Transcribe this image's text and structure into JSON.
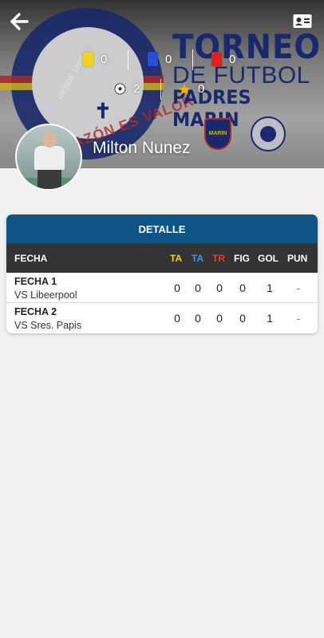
{
  "banner": {
    "title_line1": "TORNEO",
    "title_line2": "DE FUTBOL",
    "title_line3": "PADRES MARIN",
    "logo_text": "CORAZÓN ES VALOR",
    "logo_year": "DESDE 1992",
    "crest_text": "MARIN",
    "colors": {
      "navy": "#1d2f7a",
      "red": "#c9302c",
      "yellow": "#e6c52c"
    }
  },
  "stats": {
    "yellow_cards": "0",
    "blue_cards": "0",
    "red_cards": "0",
    "goals": "2",
    "stars": "0"
  },
  "player": {
    "name": "Milton Nunez"
  },
  "detail": {
    "title": "DETALLE",
    "columns": [
      "FECHA",
      "TA",
      "TA",
      "TR",
      "FIG",
      "GOL",
      "PUN"
    ],
    "column_colors": [
      "#ffffff",
      "#f5d200",
      "#3d9be9",
      "#e23b3b",
      "#ffffff",
      "#ffffff",
      "#ffffff"
    ],
    "rows": [
      {
        "fecha": "FECHA 1",
        "vs": "VS Libeerpool",
        "ta": "0",
        "ta2": "0",
        "tr": "0",
        "fig": "0",
        "gol": "1",
        "pun": "-"
      },
      {
        "fecha": "FECHA 2",
        "vs": "VS Sres. Papis",
        "ta": "0",
        "ta2": "0",
        "tr": "0",
        "fig": "0",
        "gol": "1",
        "pun": "-"
      }
    ]
  },
  "icons": {
    "back": "arrow-left-icon",
    "profile_card": "id-card-icon",
    "yellow_card": "yellow-card-icon",
    "blue_card": "blue-card-icon",
    "red_card": "red-card-icon",
    "ball": "soccer-ball-icon",
    "star": "star-icon"
  }
}
